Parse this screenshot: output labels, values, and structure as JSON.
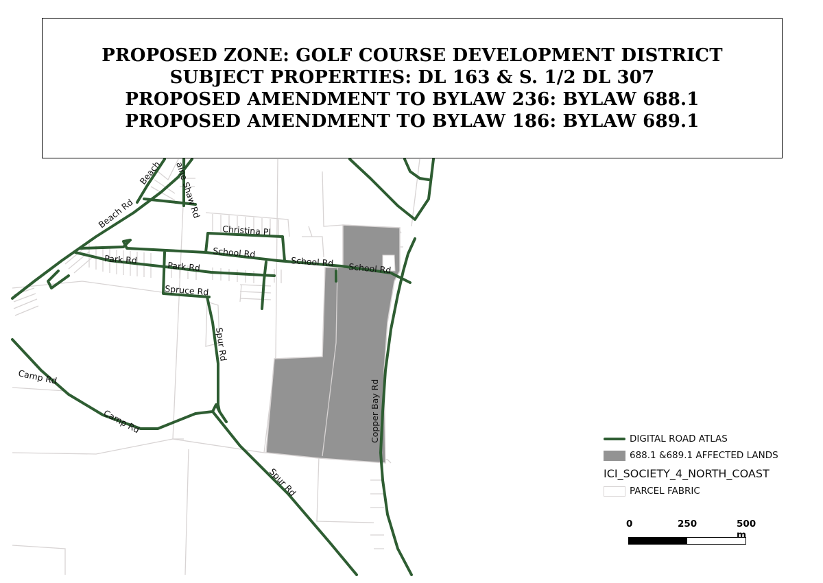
{
  "title": {
    "lines": [
      "PROPOSED ZONE: GOLF COURSE DEVELOPMENT DISTRICT",
      "SUBJECT PROPERTIES: DL 163 & S. 1/2 DL 307",
      "PROPOSED AMENDMENT TO BYLAW 236: BYLAW 688.1",
      "PROPOSED AMENDMENT TO BYLAW 186: BYLAW 689.1"
    ]
  },
  "roads": {
    "beach_rd_1": "Beach Rd",
    "beach_rd_2": "Beach",
    "shaw_rd": "aine Shaw Rd",
    "christina_pl": "Christina Pl",
    "school_rd_1": "School Rd",
    "school_rd_2": "School Rd",
    "school_rd_3": "School Rd",
    "park_rd_1": "Park Rd",
    "park_rd_2": "Park Rd",
    "spruce_rd": "Spruce Rd",
    "spur_rd_1": "Spur Rd",
    "spur_rd_2": "Spur Rd",
    "camp_rd_1": "Camp Rd",
    "camp_rd_2": "Camp Rd",
    "copper_bay_rd": "Copper Bay Rd"
  },
  "legend": {
    "road_atlas": "DIGITAL ROAD ATLAS",
    "affected_lands": "688.1 &689.1 AFFECTED LANDS",
    "group_title": "ICI_SOCIETY_4_NORTH_COAST",
    "parcel_fabric": "PARCEL FABRIC"
  },
  "scale": {
    "tick_0": "0",
    "tick_1": "250",
    "tick_2": "500 m"
  },
  "colors": {
    "road": "#2e5d32",
    "affected": "#939393",
    "parcel": "#d8d4d4"
  }
}
